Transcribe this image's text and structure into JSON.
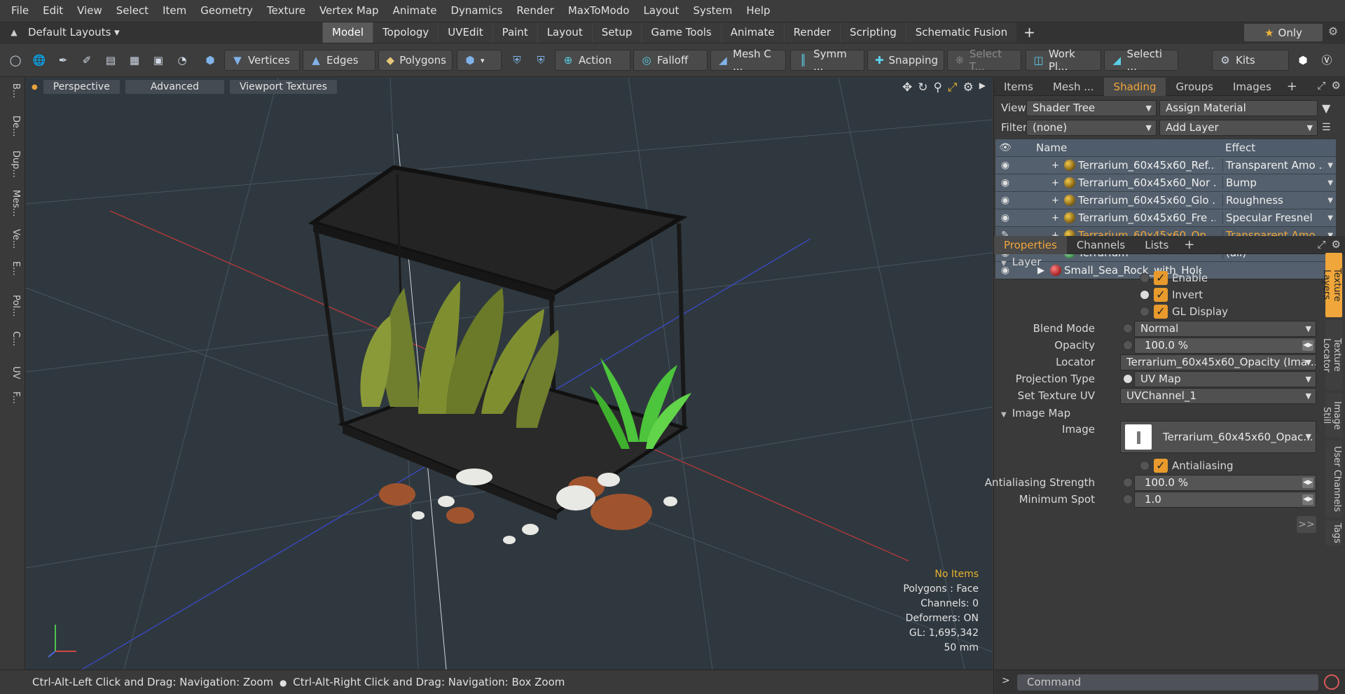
{
  "menu": [
    "File",
    "Edit",
    "View",
    "Select",
    "Item",
    "Geometry",
    "Texture",
    "Vertex Map",
    "Animate",
    "Dynamics",
    "Render",
    "MaxToModo",
    "Layout",
    "System",
    "Help"
  ],
  "layoutbar": {
    "default_layouts": "Default Layouts",
    "tabs": [
      "Model",
      "Topology",
      "UVEdit",
      "Paint",
      "Layout",
      "Setup",
      "Game Tools",
      "Animate",
      "Render",
      "Scripting",
      "Schematic Fusion"
    ],
    "active_tab": "Model",
    "only_label": "Only"
  },
  "toolbar": {
    "vertices": "Vertices",
    "edges": "Edges",
    "polygons": "Polygons",
    "action": "Action",
    "falloff": "Falloff",
    "mesh_c": "Mesh C ...",
    "symm": "Symm ...",
    "snapping": "Snapping",
    "select_t": "Select T...",
    "work_pl": "Work Pl...",
    "selecti": "Selecti ...",
    "kits": "Kits"
  },
  "left_strip": [
    "B...",
    "De...",
    "Dup...",
    "Mes...",
    "Ve...",
    "E...",
    "Pol...",
    "C...",
    "UV",
    "F..."
  ],
  "viewport": {
    "perspective": "Perspective",
    "advanced": "Advanced",
    "viewport_textures": "Viewport Textures",
    "info": {
      "items": "No Items",
      "polygons": "Polygons : Face",
      "channels": "Channels: 0",
      "deformers": "Deformers: ON",
      "gl": "GL: 1,695,342",
      "scale": "50 mm"
    }
  },
  "statusbar": {
    "hint1": "Ctrl-Alt-Left Click and Drag: Navigation: Zoom",
    "hint2": "Ctrl-Alt-Right Click and Drag: Navigation: Box Zoom"
  },
  "shading_panel": {
    "tabs": [
      "Items",
      "Mesh ...",
      "Shading",
      "Groups",
      "Images"
    ],
    "active_tab": "Shading",
    "view_label": "View",
    "view_value": "Shader Tree",
    "assign_material": "Assign Material",
    "filter_label": "Filter",
    "filter_value": "(none)",
    "add_layer": "Add Layer",
    "col_name": "Name",
    "col_effect": "Effect",
    "rows": [
      {
        "name": "Terrarium_60x45x60_Ref...",
        "effect": "Transparent Amo ..."
      },
      {
        "name": "Terrarium_60x45x60_Nor ...",
        "effect": "Bump"
      },
      {
        "name": "Terrarium_60x45x60_Glo ...",
        "effect": "Roughness"
      },
      {
        "name": "Terrarium_60x45x60_Fre ...",
        "effect": "Specular Fresnel"
      },
      {
        "name": "Terrarium_60x45x60_Op ...",
        "effect": "Transparent Amo ..."
      },
      {
        "name": "Terrarium",
        "effect": "(all)"
      },
      {
        "name": "Small_Sea_Rock_with_Holes...",
        "effect": ""
      }
    ]
  },
  "properties_panel": {
    "tabs": [
      "Properties",
      "Channels",
      "Lists"
    ],
    "active_tab": "Properties",
    "section_layer": "Layer",
    "enable": "Enable",
    "invert": "Invert",
    "gl_display": "GL Display",
    "blend_mode_label": "Blend Mode",
    "blend_mode": "Normal",
    "opacity_label": "Opacity",
    "opacity": "100.0 %",
    "locator_label": "Locator",
    "locator": "Terrarium_60x45x60_Opacity (Ima ...",
    "projection_label": "Projection Type",
    "projection": "UV Map",
    "set_uv_label": "Set Texture UV",
    "set_uv": "UVChannel_1",
    "section_image_map": "Image Map",
    "image_label": "Image",
    "image": "Terrarium_60x45x60_Opac...",
    "antialiasing": "Antialiasing",
    "aa_strength_label": "Antialiasing Strength",
    "aa_strength": "100.0 %",
    "min_spot_label": "Minimum Spot",
    "min_spot": "1.0",
    "more": ">>"
  },
  "side_tabs": [
    "Texture Layers",
    "Texture Locator",
    "Image Still",
    "User Channels",
    "Tags"
  ],
  "command": {
    "placeholder": "Command"
  },
  "colors": {
    "accent": "#f0a63a",
    "viewport_bg": "#2f383f"
  }
}
